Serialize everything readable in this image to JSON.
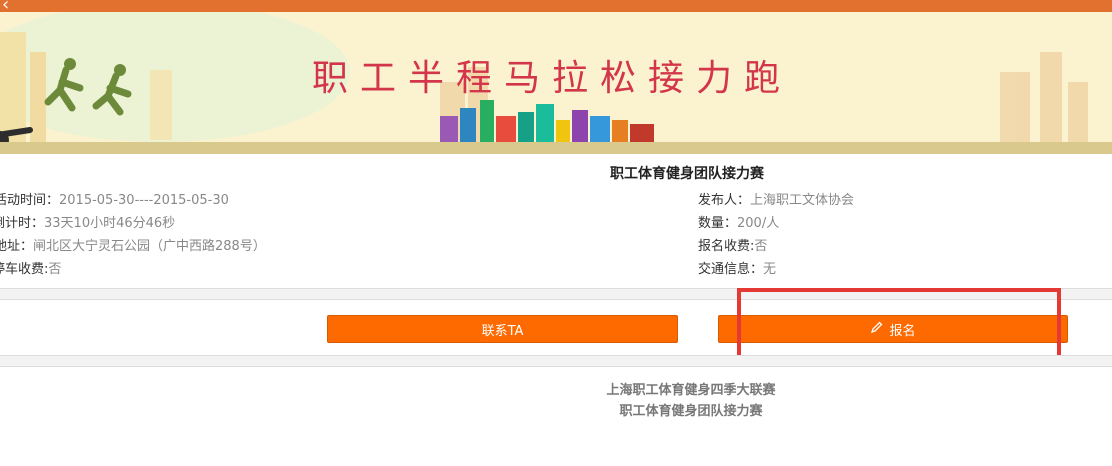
{
  "header": {
    "back_icon": "back-arrow-icon"
  },
  "banner": {
    "title": "职工半程马拉松接力跑"
  },
  "event": {
    "title": "职工体育健身团队接力赛",
    "left": [
      {
        "label": "活动时间：",
        "value": "2015-05-30----2015-05-30"
      },
      {
        "label": "倒计时：",
        "value": "33天10小时46分46秒"
      },
      {
        "label": "地址：",
        "value": "闸北区大宁灵石公园（广中西路288号）"
      },
      {
        "label": "停车收费:",
        "value": "否"
      }
    ],
    "right": [
      {
        "label": "发布人：",
        "value": "上海职工文体协会"
      },
      {
        "label": "数量：",
        "value": "200/人"
      },
      {
        "label": "报名收费:",
        "value": "否"
      },
      {
        "label": "交通信息：",
        "value": "无"
      }
    ]
  },
  "actions": {
    "contact_label": "联系TA",
    "register_label": "报名",
    "register_icon": "pencil-icon"
  },
  "colors": {
    "accent": "#ff6a00",
    "topbar": "#e2702e",
    "highlight": "#e53935"
  },
  "description": {
    "line1": "上海职工体育健身四季大联赛",
    "line2": "职工体育健身团队接力赛"
  }
}
